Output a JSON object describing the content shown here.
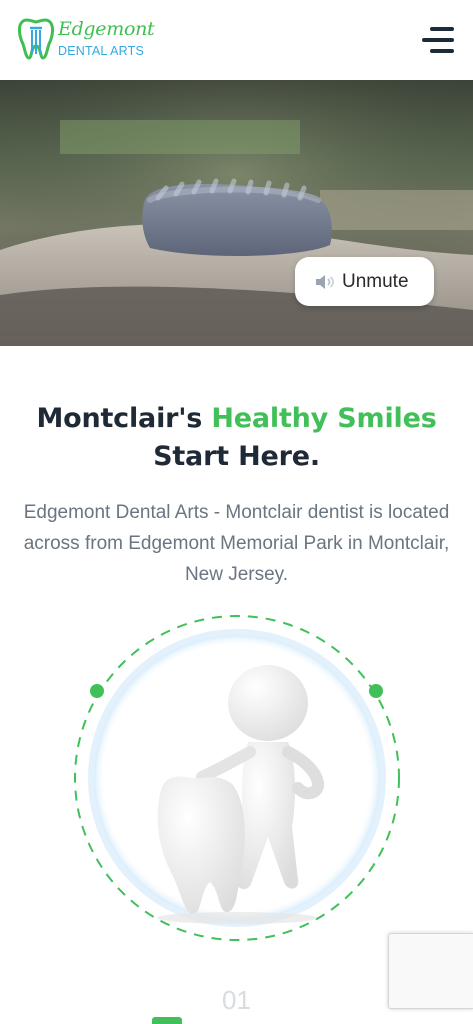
{
  "header": {
    "logo_script": "Edgemont",
    "logo_sub": "DENTAL ARTS",
    "menu_icon": "hamburger-menu-icon"
  },
  "hero": {
    "unmute_label": "Unmute",
    "unmute_icon": "speaker-icon"
  },
  "intro": {
    "headline_prefix": "Montclair's ",
    "headline_highlight": "Healthy Smiles",
    "headline_suffix": "Start Here.",
    "description": "Edgemont Dental Arts - Montclair dentist is located across from Edgemont Memorial Park in Montclair, New Jersey."
  },
  "step": {
    "number": "01"
  },
  "colors": {
    "brand_green": "#41c05a",
    "brand_blue": "#36a8e0",
    "heading": "#1f2a36",
    "body_text": "#6a7582"
  }
}
